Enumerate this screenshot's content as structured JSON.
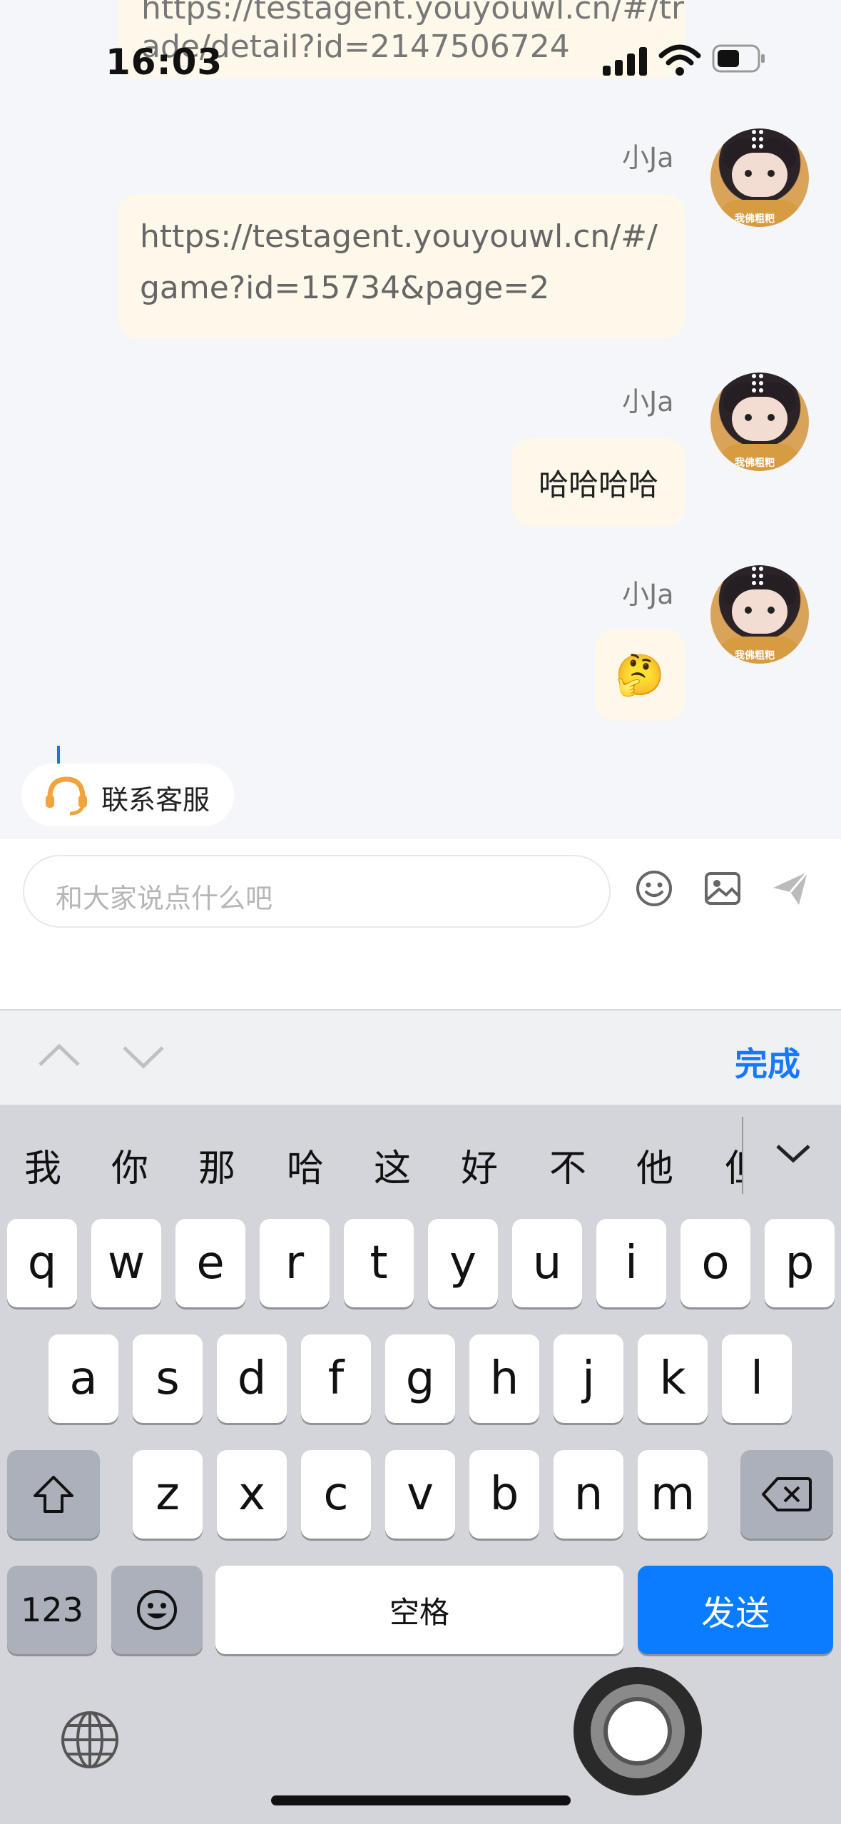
{
  "status_bar": {
    "time": "16:03"
  },
  "chat": {
    "top_partial_message": {
      "line1": "https://testagent.youyouwl.cn/#/tr",
      "line2": "ade/detail?id=2147506724"
    },
    "messages": [
      {
        "sender": "小Ja",
        "text": "https://testagent.youyouwl.cn/#/game?id=15734&page=2"
      },
      {
        "sender": "小Ja",
        "text": "哈哈哈哈"
      },
      {
        "sender": "小Ja",
        "text": "🤔"
      }
    ],
    "avatar_tag": "我佛粗粑",
    "contact_service": "联系客服"
  },
  "composer": {
    "placeholder": "和大家说点什么吧",
    "icons": [
      "emoji-icon",
      "image-icon",
      "send-icon"
    ]
  },
  "keyboard_toolbar": {
    "done": "完成"
  },
  "candidates": [
    "我",
    "你",
    "那",
    "哈",
    "这",
    "好",
    "不",
    "他",
    "但"
  ],
  "keys": {
    "row1": [
      "q",
      "w",
      "e",
      "r",
      "t",
      "y",
      "u",
      "i",
      "o",
      "p"
    ],
    "row2": [
      "a",
      "s",
      "d",
      "f",
      "g",
      "h",
      "j",
      "k",
      "l"
    ],
    "row3": [
      "z",
      "x",
      "c",
      "v",
      "b",
      "n",
      "m"
    ],
    "num": "123",
    "space": "空格",
    "send": "发送"
  },
  "colors": {
    "accent": "#1677ff",
    "bubble": "#fdf8ea",
    "keyboard_bg": "#d3d5db",
    "send_key": "#0a7cff"
  }
}
